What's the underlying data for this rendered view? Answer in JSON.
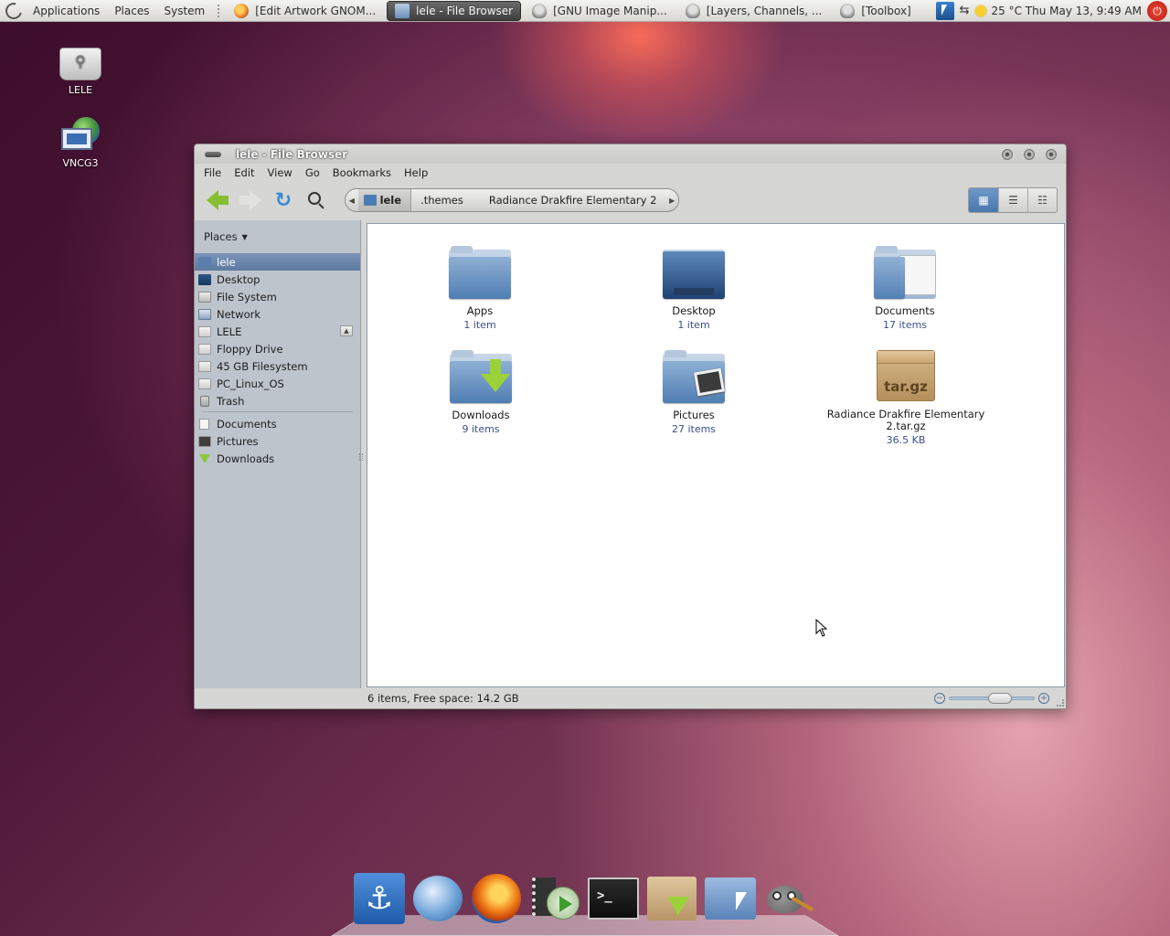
{
  "top_panel": {
    "menus": [
      "Applications",
      "Places",
      "System"
    ],
    "tasks": [
      {
        "label": "[Edit Artwork GNOM...",
        "icon": "firefox-icon",
        "active": false
      },
      {
        "label": "lele - File Browser",
        "icon": "folder-icon",
        "active": true
      },
      {
        "label": "[GNU Image Manip...",
        "icon": "gimp-icon",
        "active": false
      },
      {
        "label": "[Layers, Channels, ...",
        "icon": "gimp-icon",
        "active": false
      },
      {
        "label": "[Toolbox]",
        "icon": "gimp-icon",
        "active": false
      }
    ],
    "clock": "25 °C  Thu May 13,  9:49 AM"
  },
  "desktop_icons": [
    {
      "label": "LELE",
      "icon": "usb-drive-icon"
    },
    {
      "label": "VNCG3",
      "icon": "vnc-computer-icon"
    }
  ],
  "window": {
    "title": "lele - File Browser",
    "menu": [
      "File",
      "Edit",
      "View",
      "Go",
      "Bookmarks",
      "Help"
    ],
    "path": [
      {
        "label": "lele",
        "home": true
      },
      {
        "label": ".themes"
      },
      {
        "label": "Radiance Drakfire Elementary 2"
      }
    ],
    "places_label": "Places",
    "places": [
      {
        "label": "lele",
        "icon": "home-icon",
        "selected": true
      },
      {
        "label": "Desktop",
        "icon": "desktop-icon"
      },
      {
        "label": "File System",
        "icon": "filesystem-icon"
      },
      {
        "label": "Network",
        "icon": "network-icon"
      },
      {
        "label": "LELE",
        "icon": "drive-icon",
        "eject": true
      },
      {
        "label": "Floppy Drive",
        "icon": "floppy-icon"
      },
      {
        "label": "45 GB Filesystem",
        "icon": "harddisk-icon"
      },
      {
        "label": "PC_Linux_OS",
        "icon": "harddisk-icon"
      },
      {
        "label": "Trash",
        "icon": "trash-icon"
      }
    ],
    "bookmarks": [
      {
        "label": "Documents",
        "icon": "document-icon"
      },
      {
        "label": "Pictures",
        "icon": "pictures-icon"
      },
      {
        "label": "Downloads",
        "icon": "downloads-icon"
      }
    ],
    "files": [
      {
        "name": "Apps",
        "info": "1 item",
        "kind": "folder"
      },
      {
        "name": "Desktop",
        "info": "1 item",
        "kind": "desktop-folder"
      },
      {
        "name": "Documents",
        "info": "17 items",
        "kind": "documents-folder"
      },
      {
        "name": "Downloads",
        "info": "9 items",
        "kind": "downloads-folder"
      },
      {
        "name": "Pictures",
        "info": "27 items",
        "kind": "pictures-folder"
      },
      {
        "name": "Radiance Drakfire Elementary 2.tar.gz",
        "info": "36.5 KB",
        "kind": "archive",
        "archive_label": "tar.gz"
      }
    ],
    "status": "6 items, Free space: 14.2 GB",
    "zoom_level": 0.62
  },
  "dock": {
    "items": [
      "anchor-icon",
      "mail-icon",
      "firefox-icon",
      "video-player-icon",
      "terminal-icon",
      "downloads-box-icon",
      "folder-pointer-icon",
      "gimp-icon"
    ],
    "terminal_glyph": ">_"
  },
  "colors": {
    "selection": "#5d7aa0",
    "link_info": "#3a4f8c",
    "accent_green": "#8cc63f"
  }
}
